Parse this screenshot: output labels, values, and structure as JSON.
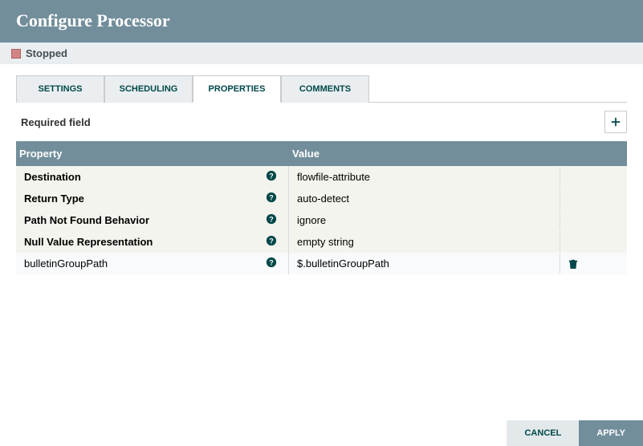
{
  "header": {
    "title": "Configure Processor"
  },
  "status": {
    "label": "Stopped",
    "color": "#d18686"
  },
  "tabs": [
    {
      "id": "settings",
      "label": "SETTINGS",
      "active": false
    },
    {
      "id": "scheduling",
      "label": "SCHEDULING",
      "active": false
    },
    {
      "id": "properties",
      "label": "PROPERTIES",
      "active": true
    },
    {
      "id": "comments",
      "label": "COMMENTS",
      "active": false
    }
  ],
  "required_label": "Required field",
  "columns": {
    "property": "Property",
    "value": "Value"
  },
  "rows": [
    {
      "name": "Destination",
      "value": "flowfile-attribute",
      "required": true,
      "custom": false
    },
    {
      "name": "Return Type",
      "value": "auto-detect",
      "required": true,
      "custom": false
    },
    {
      "name": "Path Not Found Behavior",
      "value": "ignore",
      "required": true,
      "custom": false
    },
    {
      "name": "Null Value Representation",
      "value": "empty string",
      "required": true,
      "custom": false
    },
    {
      "name": "bulletinGroupPath",
      "value": "$.bulletinGroupPath",
      "required": false,
      "custom": true
    }
  ],
  "buttons": {
    "cancel": "CANCEL",
    "apply": "APPLY"
  },
  "colors": {
    "brand": "#728e9b",
    "accent": "#004849"
  }
}
